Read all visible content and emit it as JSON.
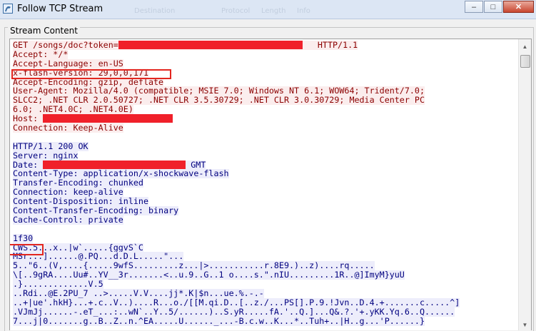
{
  "window": {
    "title": "Follow TCP Stream",
    "background_columns": [
      "Destination",
      "Protocol",
      "Length",
      "Info"
    ],
    "buttons": {
      "minimize": "–",
      "maximize": "□",
      "close": "✕"
    }
  },
  "group_label": "Stream Content",
  "request_lines": [
    {
      "id": "req-get",
      "parts": [
        "GET /songs/doc?token=",
        {
          "redact": "token-redacted",
          "w": 258
        },
        "   HTTP/1.1"
      ]
    },
    {
      "id": "req-accept",
      "parts": [
        "Accept: */*"
      ]
    },
    {
      "id": "req-accept-language",
      "parts": [
        "Accept-Language: en-US"
      ]
    },
    {
      "id": "req-flash-version",
      "parts": [
        "x-flash-version: 29,0,0,171"
      ]
    },
    {
      "id": "req-accept-encoding",
      "parts": [
        "Accept-Encoding: gzip, deflate"
      ]
    },
    {
      "id": "req-user-agent",
      "parts": [
        "User-Agent: Mozilla/4.0 (compatible; MSIE 7.0; Windows NT 6.1; WOW64; Trident/7.0;"
      ]
    },
    {
      "id": "req-user-agent-2",
      "parts": [
        "SLCC2; .NET CLR 2.0.50727; .NET CLR 3.5.30729; .NET CLR 3.0.30729; Media Center PC"
      ]
    },
    {
      "id": "req-user-agent-3",
      "parts": [
        "6.0; .NET4.0C; .NET4.0E)"
      ]
    },
    {
      "id": "req-host",
      "parts": [
        "Host: ",
        {
          "redact": "host-redacted",
          "w": 182
        }
      ]
    },
    {
      "id": "req-connection",
      "parts": [
        "Connection: Keep-Alive"
      ]
    }
  ],
  "response_lines": [
    {
      "id": "resp-blank",
      "parts": [
        ""
      ]
    },
    {
      "id": "resp-status",
      "parts": [
        "HTTP/1.1 200 OK"
      ]
    },
    {
      "id": "resp-server",
      "parts": [
        "Server: nginx"
      ]
    },
    {
      "id": "resp-date",
      "parts": [
        "Date: ",
        {
          "redact": "date-redacted",
          "w": 200
        },
        " GMT"
      ]
    },
    {
      "id": "resp-content-type",
      "parts": [
        "Content-Type: application/x-shockwave-flash"
      ]
    },
    {
      "id": "resp-transfer-encoding",
      "parts": [
        "Transfer-Encoding: chunked"
      ]
    },
    {
      "id": "resp-connection",
      "parts": [
        "Connection: keep-alive"
      ]
    },
    {
      "id": "resp-content-disposition",
      "parts": [
        "Content-Disposition: inline"
      ]
    },
    {
      "id": "resp-content-transfer-encoding",
      "parts": [
        "Content-Transfer-Encoding: binary"
      ]
    },
    {
      "id": "resp-cache-control",
      "parts": [
        "Cache-Control: private"
      ]
    },
    {
      "id": "resp-blank-2",
      "parts": [
        ""
      ]
    },
    {
      "id": "resp-chunk-size",
      "parts": [
        "1f30"
      ]
    },
    {
      "id": "resp-cws",
      "parts": [
        "CWS.5...x..|w`.....{ggvS`C"
      ]
    },
    {
      "id": "resp-bin-1",
      "parts": [
        "MSr...]......@.PQ...d.D.L.....\"..."
      ]
    },
    {
      "id": "resp-bin-2",
      "parts": [
        "5..\"6..(V,....{.....9wfS.........z...|>...........r.8E9.)..z)....rq....."
      ]
    },
    {
      "id": "resp-bin-3",
      "parts": [
        "\\[..9gRA....Uu#..YV__3r.......<..u.9..G..1 o....s.\".nIU.........1R..@]ImyM}yuU"
      ]
    },
    {
      "id": "resp-bin-4",
      "parts": [
        ".}.............V.5"
      ]
    },
    {
      "id": "resp-bin-5",
      "parts": [
        "..Rdi..@E.2PU_7 ..>.....V.V....jj*.K|$n...ue.%.-.-"
      ]
    },
    {
      "id": "resp-bin-6",
      "parts": [
        "..+|ue'.hkH}...+.c..V..)....R...o./[[M.qi.D..[..z./...PS[].P.9.!Jvn..D.4.+.......c.....^]"
      ]
    },
    {
      "id": "resp-bin-7",
      "parts": [
        ".VJmJj......-.eT_...:..wN`..Y..5/......)..S.yR.....fA.'..Q.]...Q&.?.'+.yKK.Yq.6..Q......"
      ]
    },
    {
      "id": "resp-bin-8",
      "parts": [
        "7...j|0.......g..B..Z..n.^EA.....U......_...-B.c.w..K...*..Tuh+..|H..g...'P......}"
      ]
    }
  ],
  "colors": {
    "client_text": "#8b0000",
    "client_bg": "#fbeded",
    "server_text": "#00007f",
    "server_bg": "#ededfb",
    "redaction": "#f0202a",
    "highlight_box": "#e3261f"
  },
  "icons": [
    "wireshark-fin-icon",
    "minimize-icon",
    "maximize-icon",
    "close-icon",
    "scroll-up-arrow-icon",
    "scroll-down-arrow-icon"
  ]
}
